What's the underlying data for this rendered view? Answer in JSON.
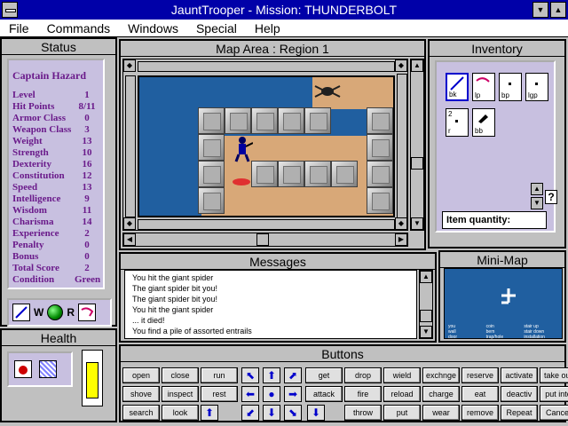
{
  "window": {
    "title": "JauntTrooper - Mission: THUNDERBOLT"
  },
  "menu": [
    "File",
    "Commands",
    "Windows",
    "Special",
    "Help"
  ],
  "status": {
    "title": "Status",
    "name": "Captain Hazard",
    "stats": [
      {
        "label": "Level",
        "value": "1"
      },
      {
        "label": "Hit Points",
        "value": "8/11"
      },
      {
        "label": "Armor Class",
        "value": "0"
      },
      {
        "label": "Weapon Class",
        "value": "3"
      },
      {
        "label": "Weight",
        "value": "13"
      },
      {
        "label": "Strength",
        "value": "10"
      },
      {
        "label": "Dexterity",
        "value": "16"
      },
      {
        "label": "Constitution",
        "value": "12"
      },
      {
        "label": "Speed",
        "value": "13"
      },
      {
        "label": "Intelligence",
        "value": "9"
      },
      {
        "label": "Wisdom",
        "value": "11"
      },
      {
        "label": "Charisma",
        "value": "14"
      },
      {
        "label": "Experience",
        "value": "2"
      },
      {
        "label": "Penalty",
        "value": "0"
      },
      {
        "label": "Bonus",
        "value": "0"
      },
      {
        "label": "Total Score",
        "value": "2"
      },
      {
        "label": "Condition",
        "value": "Green"
      }
    ],
    "equip_labels": {
      "w": "W",
      "r": "R"
    }
  },
  "map": {
    "title": "Map Area : Region 1"
  },
  "inventory": {
    "title": "Inventory",
    "items": [
      {
        "label": "bk",
        "count": ""
      },
      {
        "label": "lp",
        "count": ""
      },
      {
        "label": "bp",
        "count": ""
      },
      {
        "label": "lgp",
        "count": ""
      },
      {
        "label": "r",
        "count": "2"
      },
      {
        "label": "bb",
        "count": ""
      }
    ],
    "quantity_label": "Item quantity:",
    "help_label": "?"
  },
  "messages": {
    "title": "Messages",
    "lines": [
      "You hit the giant spider",
      "The giant spider bit you!",
      "The giant spider bit you!",
      "You hit the giant spider",
      "... it died!",
      "You find a pile of assorted entrails"
    ]
  },
  "minimap": {
    "title": "Mini-Map",
    "legend": [
      "you",
      "coin",
      "stair up",
      "wall",
      "bem",
      "stair down",
      "door",
      "trap/hole",
      "installation"
    ]
  },
  "health": {
    "title": "Health",
    "level": 0.73
  },
  "buttons": {
    "title": "Buttons",
    "row1": [
      "open",
      "close",
      "run",
      "get",
      "drop",
      "wield",
      "exchnge",
      "reserve",
      "activate",
      "take out"
    ],
    "row2": [
      "shove",
      "inspect",
      "rest",
      "attack",
      "fire",
      "reload",
      "charge",
      "eat",
      "deactiv",
      "put into"
    ],
    "row3": [
      "search",
      "look",
      "throw",
      "put",
      "wear",
      "remove",
      "Repeat",
      "Cancel"
    ]
  },
  "colors": {
    "title_bar": "#0000a8",
    "panel_lavender": "#c8c0e0",
    "stat_text": "#6a1a8a",
    "map_water": "#205fa0",
    "map_floor": "#d8a878"
  }
}
